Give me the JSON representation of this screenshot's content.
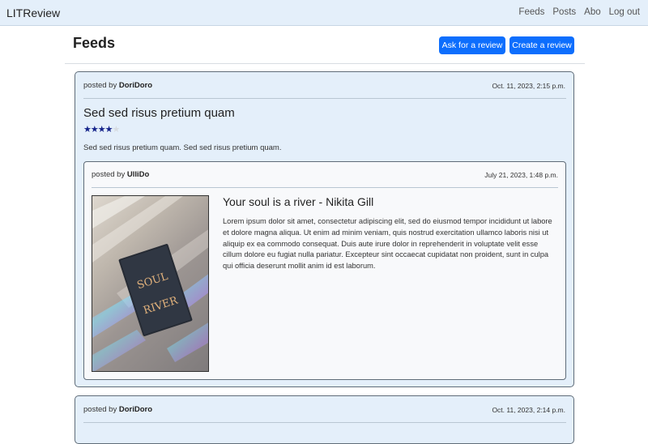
{
  "navbar": {
    "brand": "LITReview",
    "links": [
      "Feeds",
      "Posts",
      "Abo",
      "Log out"
    ]
  },
  "page": {
    "title": "Feeds",
    "ask_button": "Ask for a review",
    "create_button": "Create a review"
  },
  "posts": [
    {
      "posted_by_label": "posted by",
      "author": "DoriDoro",
      "date": "Oct. 11, 2023, 2:15 p.m.",
      "review_title": "Sed sed risus pretium quam",
      "rating": 4,
      "max_rating": 5,
      "body": "Sed sed risus pretium quam. Sed sed risus pretium quam.",
      "ticket": {
        "posted_by_label": "posted by",
        "author": "UlliDo",
        "date": "July 21, 2023, 1:48 p.m.",
        "title": "Your soul is a river - Nikita Gill",
        "description": "Lorem ipsum dolor sit amet, consectetur adipiscing elit, sed do eiusmod tempor incididunt ut labore et dolore magna aliqua. Ut enim ad minim veniam, quis nostrud exercitation ullamco laboris nisi ut aliquip ex ea commodo consequat. Duis aute irure dolor in reprehenderit in voluptate velit esse cillum dolore eu fugiat nulla pariatur. Excepteur sint occaecat cupidatat non proident, sunt in culpa qui officia deserunt mollit anim id est laborum.",
        "cover_text": [
          "SOUL",
          "RIVER"
        ]
      }
    },
    {
      "posted_by_label": "posted by",
      "author": "DoriDoro",
      "date": "Oct. 11, 2023, 2:14 p.m."
    }
  ],
  "colors": {
    "navbar_bg": "#e4effa",
    "card_bg": "#e4effa",
    "primary": "#0d6efd",
    "star": "#14238a"
  }
}
